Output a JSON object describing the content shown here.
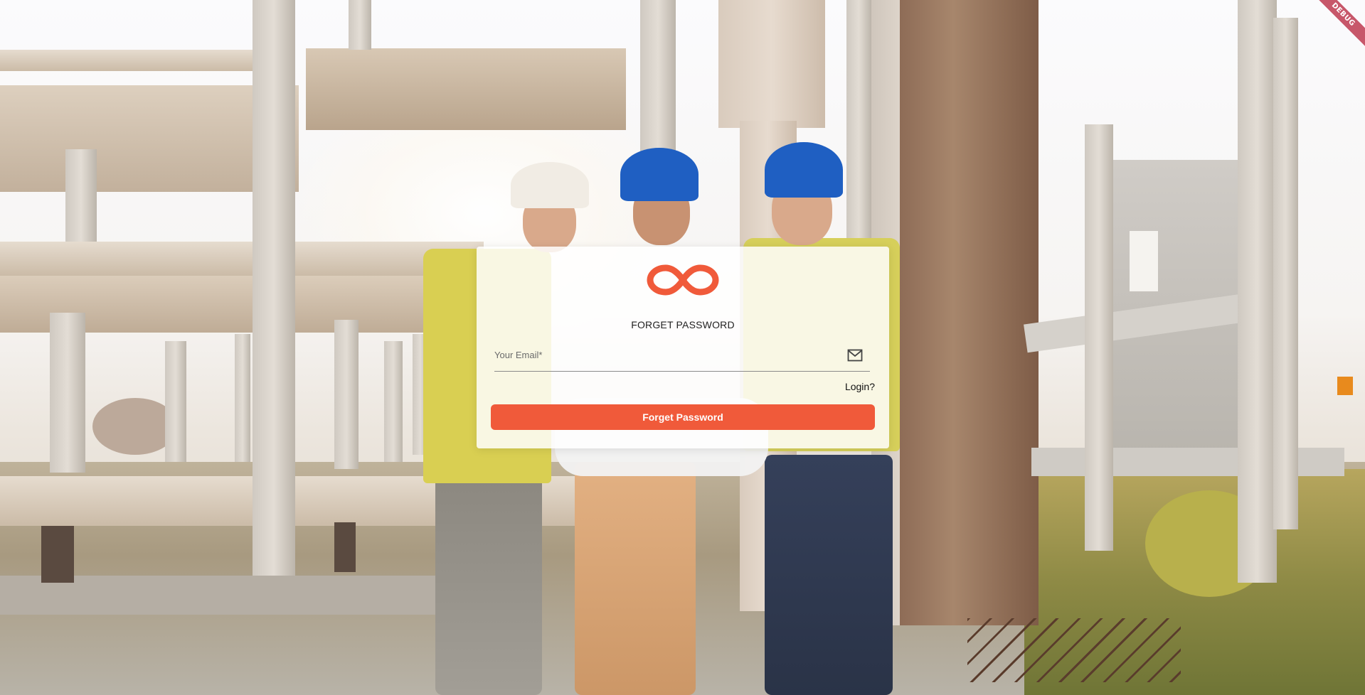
{
  "debug_banner": "DEBUG",
  "brand": {
    "logo_icon": "infinity-logo-icon",
    "accent_color": "#f05a3a"
  },
  "card": {
    "title": "FORGET PASSWORD",
    "email_field": {
      "placeholder": "Your Email*",
      "value": "",
      "icon": "mail-icon"
    },
    "login_link": "Login?",
    "submit_label": "Forget Password"
  },
  "background": {
    "description_icon": "construction-site-background"
  }
}
